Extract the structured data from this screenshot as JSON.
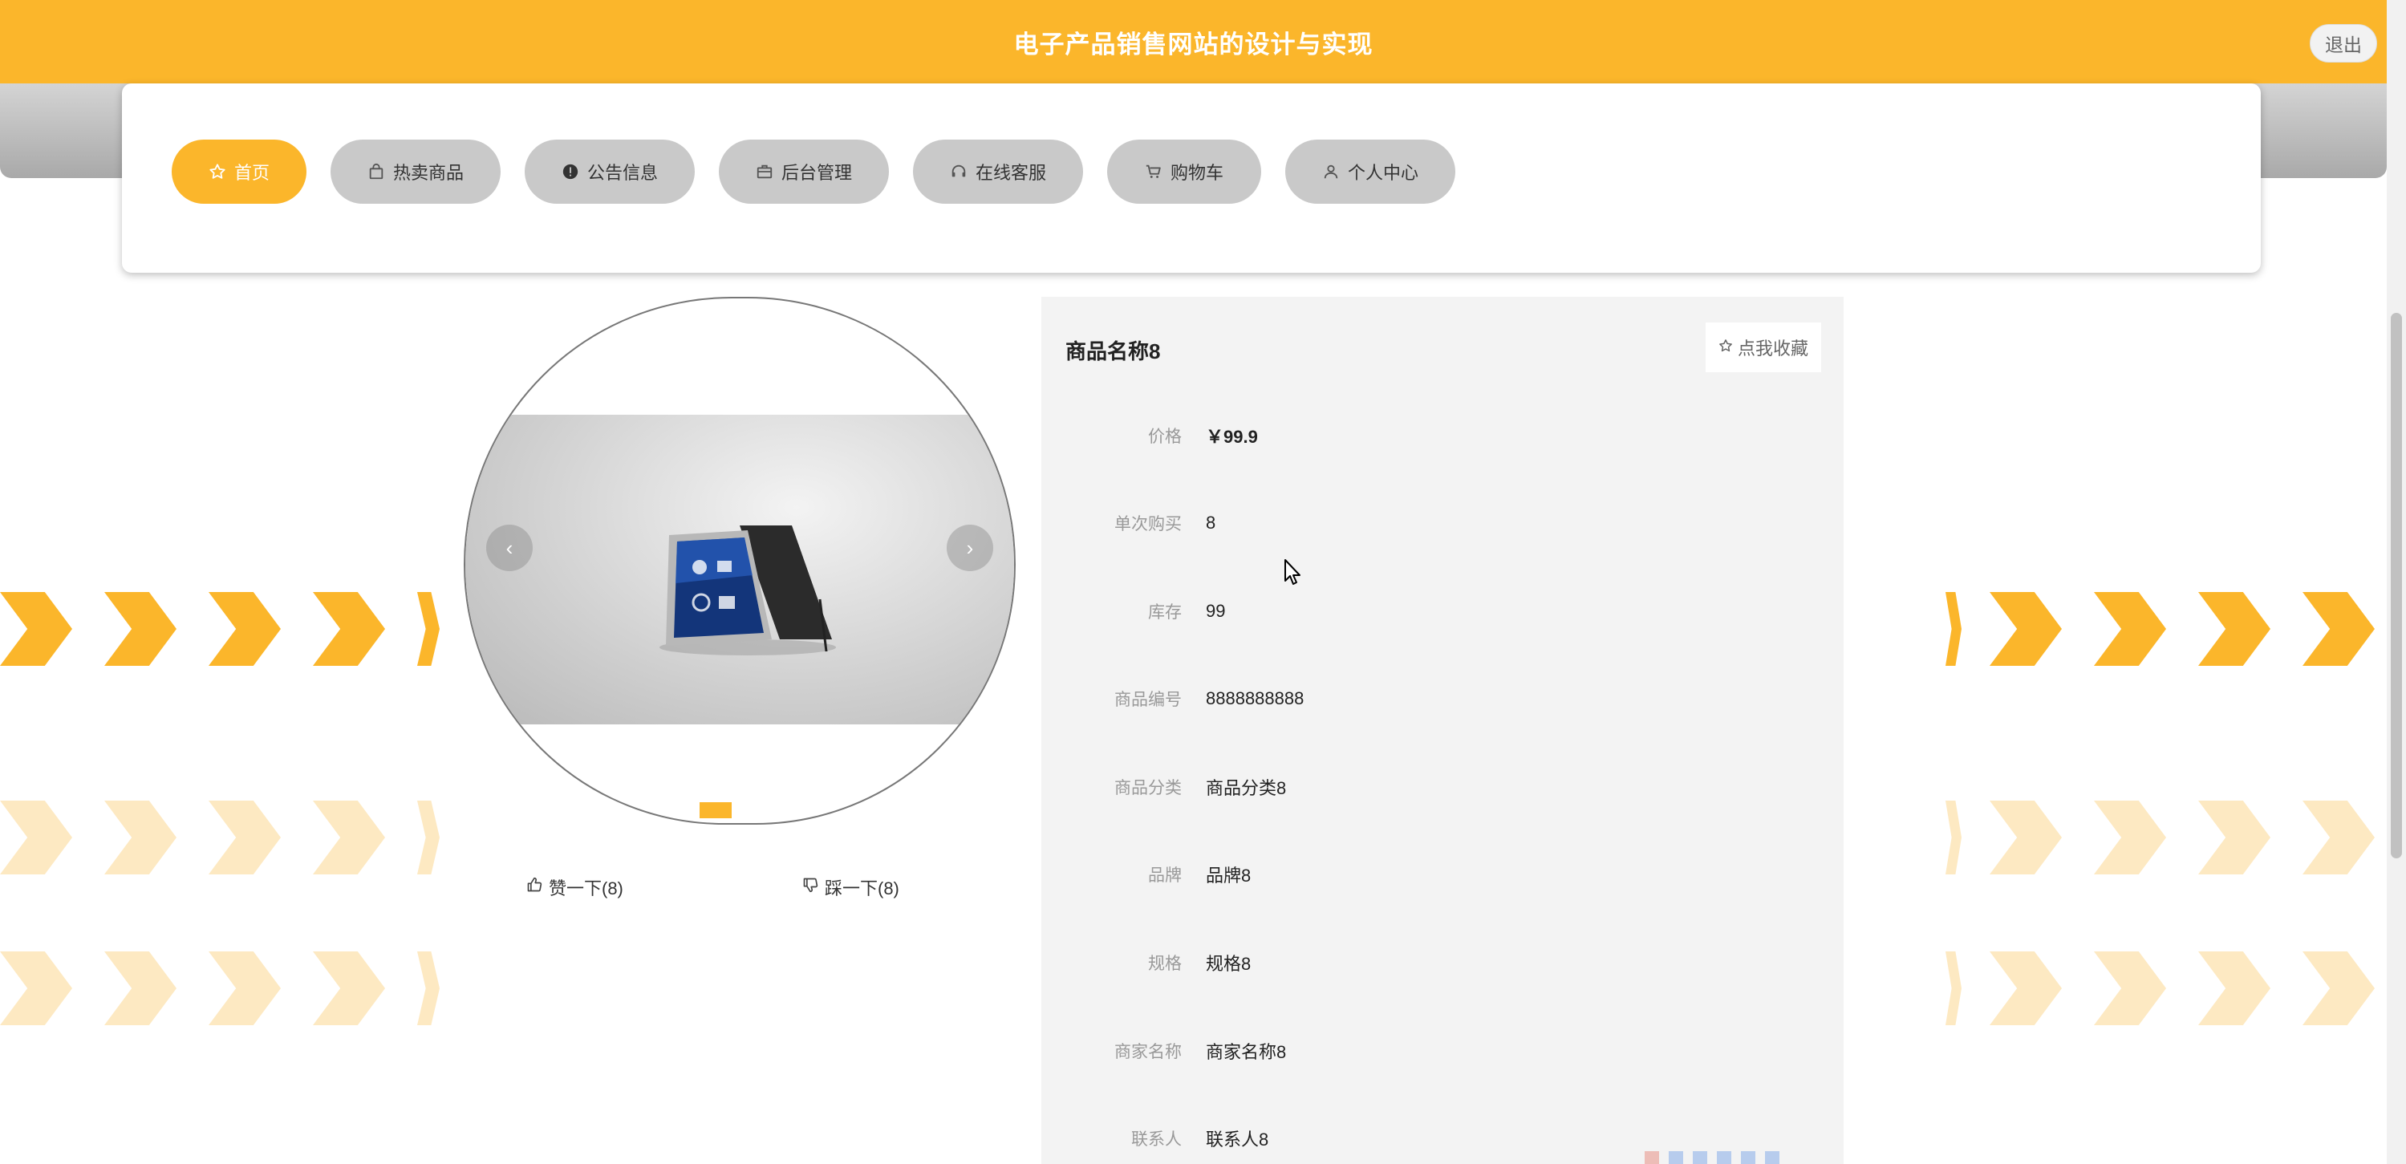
{
  "header": {
    "title": "电子产品销售网站的设计与实现",
    "logout_label": "退出"
  },
  "nav": {
    "items": [
      {
        "label": "首页",
        "icon": "star-icon",
        "active": true
      },
      {
        "label": "热卖商品",
        "icon": "bag-icon",
        "active": false
      },
      {
        "label": "公告信息",
        "icon": "info-icon",
        "active": false
      },
      {
        "label": "后台管理",
        "icon": "briefcase-icon",
        "active": false
      },
      {
        "label": "在线客服",
        "icon": "headset-icon",
        "active": false
      },
      {
        "label": "购物车",
        "icon": "cart-icon",
        "active": false
      },
      {
        "label": "个人中心",
        "icon": "user-icon",
        "active": false
      }
    ]
  },
  "gallery": {
    "image": "tablet-device-photo",
    "slides": 1,
    "current": 1
  },
  "votes": {
    "like_label": "赞一下(8)",
    "dislike_label": "踩一下(8)"
  },
  "product": {
    "name": "商品名称8",
    "favorite_label": "点我收藏",
    "fields": [
      {
        "label": "价格",
        "value": "￥99.9"
      },
      {
        "label": "单次购买",
        "value": "8"
      },
      {
        "label": "库存",
        "value": "99"
      },
      {
        "label": "商品编号",
        "value": "8888888888"
      },
      {
        "label": "商品分类",
        "value": "商品分类8"
      },
      {
        "label": "品牌",
        "value": "品牌8"
      },
      {
        "label": "规格",
        "value": "规格8"
      },
      {
        "label": "商家名称",
        "value": "商家名称8"
      },
      {
        "label": "联系人",
        "value": "联系人8"
      }
    ]
  },
  "colors": {
    "accent": "#fbb62b",
    "nav_inactive": "#c9c9c9",
    "panel": "#f3f3f3"
  }
}
